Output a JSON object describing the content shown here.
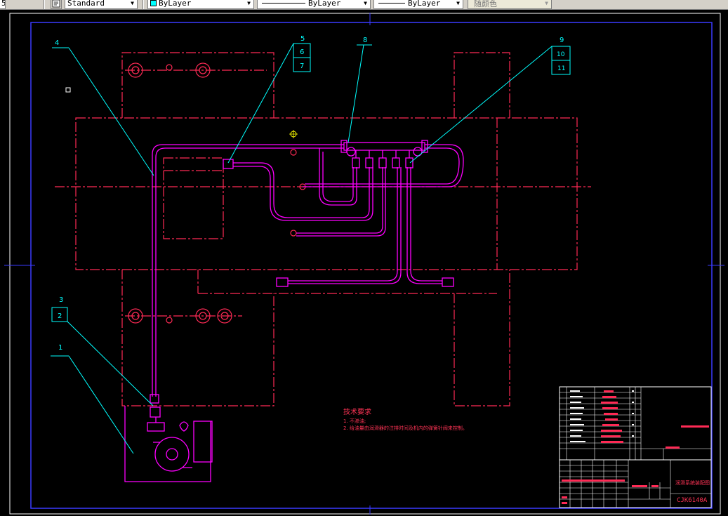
{
  "toolbar": {
    "text_style": "Standard",
    "layer": "ByLayer",
    "linetype": "ByLayer",
    "lineweight": "ByLayer",
    "plot_style": "随颜色",
    "left_value": "5"
  },
  "drawing": {
    "balloons": {
      "b1": "1",
      "b2": "2",
      "b3": "3",
      "b4": "4",
      "b5": "5",
      "b6": "6",
      "b7": "7",
      "b8": "8",
      "b9": "9",
      "b10": "10",
      "b11": "11"
    },
    "technical_requirements": {
      "title": "技术要求",
      "note1": "1. 不渗油;",
      "note2": "2. 给油量由润滑器的注排时间及机内的弹簧针阀来控制。"
    },
    "title_block": {
      "drawing_name": "润滑系统装配图",
      "drawing_code": "CJK6140A"
    }
  },
  "colors": {
    "magenta": "#ff00ff",
    "red": "#ff2a55",
    "cyan": "#00ffff",
    "blue_frame": "#2a2aff"
  }
}
